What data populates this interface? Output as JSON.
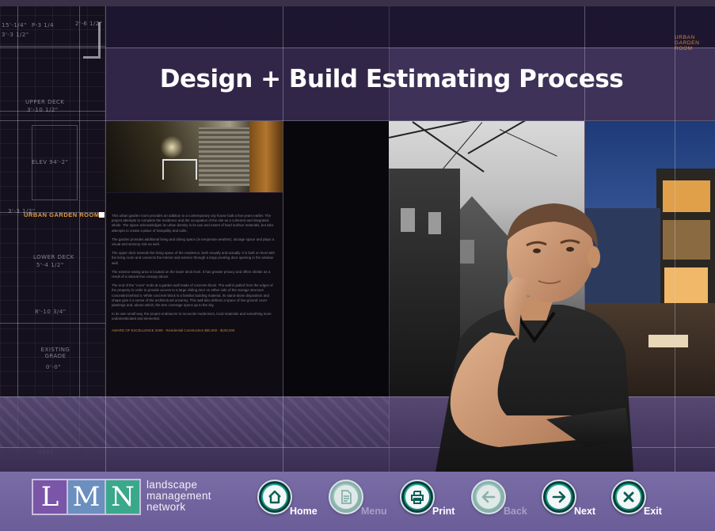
{
  "slide": {
    "title": "Design + Build Estimating Process",
    "badge_top": "URBAN GARDEN ROOM",
    "blueprint": {
      "labels": [
        "15'-1/4\"",
        "P-3 1/4",
        "2'-6 1/2\"",
        "3'-3 1/2\"",
        "UPPER DECK",
        "3'-10 1/2\"",
        "ELEV 94'-2\"",
        "3'-3 1/2\"",
        "LOWER DECK",
        "5'-4 1/2\"",
        "8'-10 3/4\"",
        "EXISTING GRADE",
        "0'-0\"",
        "0401"
      ],
      "highlight_label": "URBAN GARDEN ROOM"
    },
    "blurb": {
      "paragraphs": [
        "This urban garden room provides an addition to a contemporary city house built a few years earlier. The project attempts to complete the residence and the occupation of the site as a coherent and integrated whole. The space acknowledges its urban density in its use and extent of hard surface materials, but also attempts to create a place of tranquility and calm.",
        "The garden provides additional living and dining space (in temperate weather), storage space and plays a visual and sensory role as well.",
        "The upper deck extends the living space of the residence, both visually and actually. It is built on level with the living room and connects the interior and exterior through a large pivoting door opening in the window wall.",
        "The exterior eating area is located on the lower deck level. It has greater privacy and offers shelter as a result of a natural tree canopy above.",
        "The end of the \"room\" ends at a garden wall made of concrete block. The wall is pulled from the edges of the property in order to provide access to a large sliding door on either side of the storage structure concealed behind it. While concrete block is a familiar building material, its stand-alone disposition and shape give it a sense of the architectural uncanny. This wall also defines a space of low ground cover plantings and, above which, the tree coverage opens up to the sky.",
        "In its own small way, the project endeavors to reconcile modernism, local materials and something more undomesticated and elemental."
      ],
      "award": "AWARD OF EXCELLENCE 2009 · Residential Construction $50,000 - $100,000"
    }
  },
  "logo": {
    "letters": [
      "L",
      "M",
      "N"
    ],
    "words": [
      "landscape",
      "management",
      "network"
    ]
  },
  "nav": {
    "home": "Home",
    "menu": "Menu",
    "print": "Print",
    "back": "Back",
    "next": "Next",
    "exit": "Exit"
  },
  "colors": {
    "nav_bar": "#7a6da6",
    "button_teal": "#11907f",
    "accent_orange": "#e39a3a",
    "logo_purple": "#7a55a8",
    "logo_blue": "#6b8fbf",
    "logo_green": "#3aa88a"
  }
}
